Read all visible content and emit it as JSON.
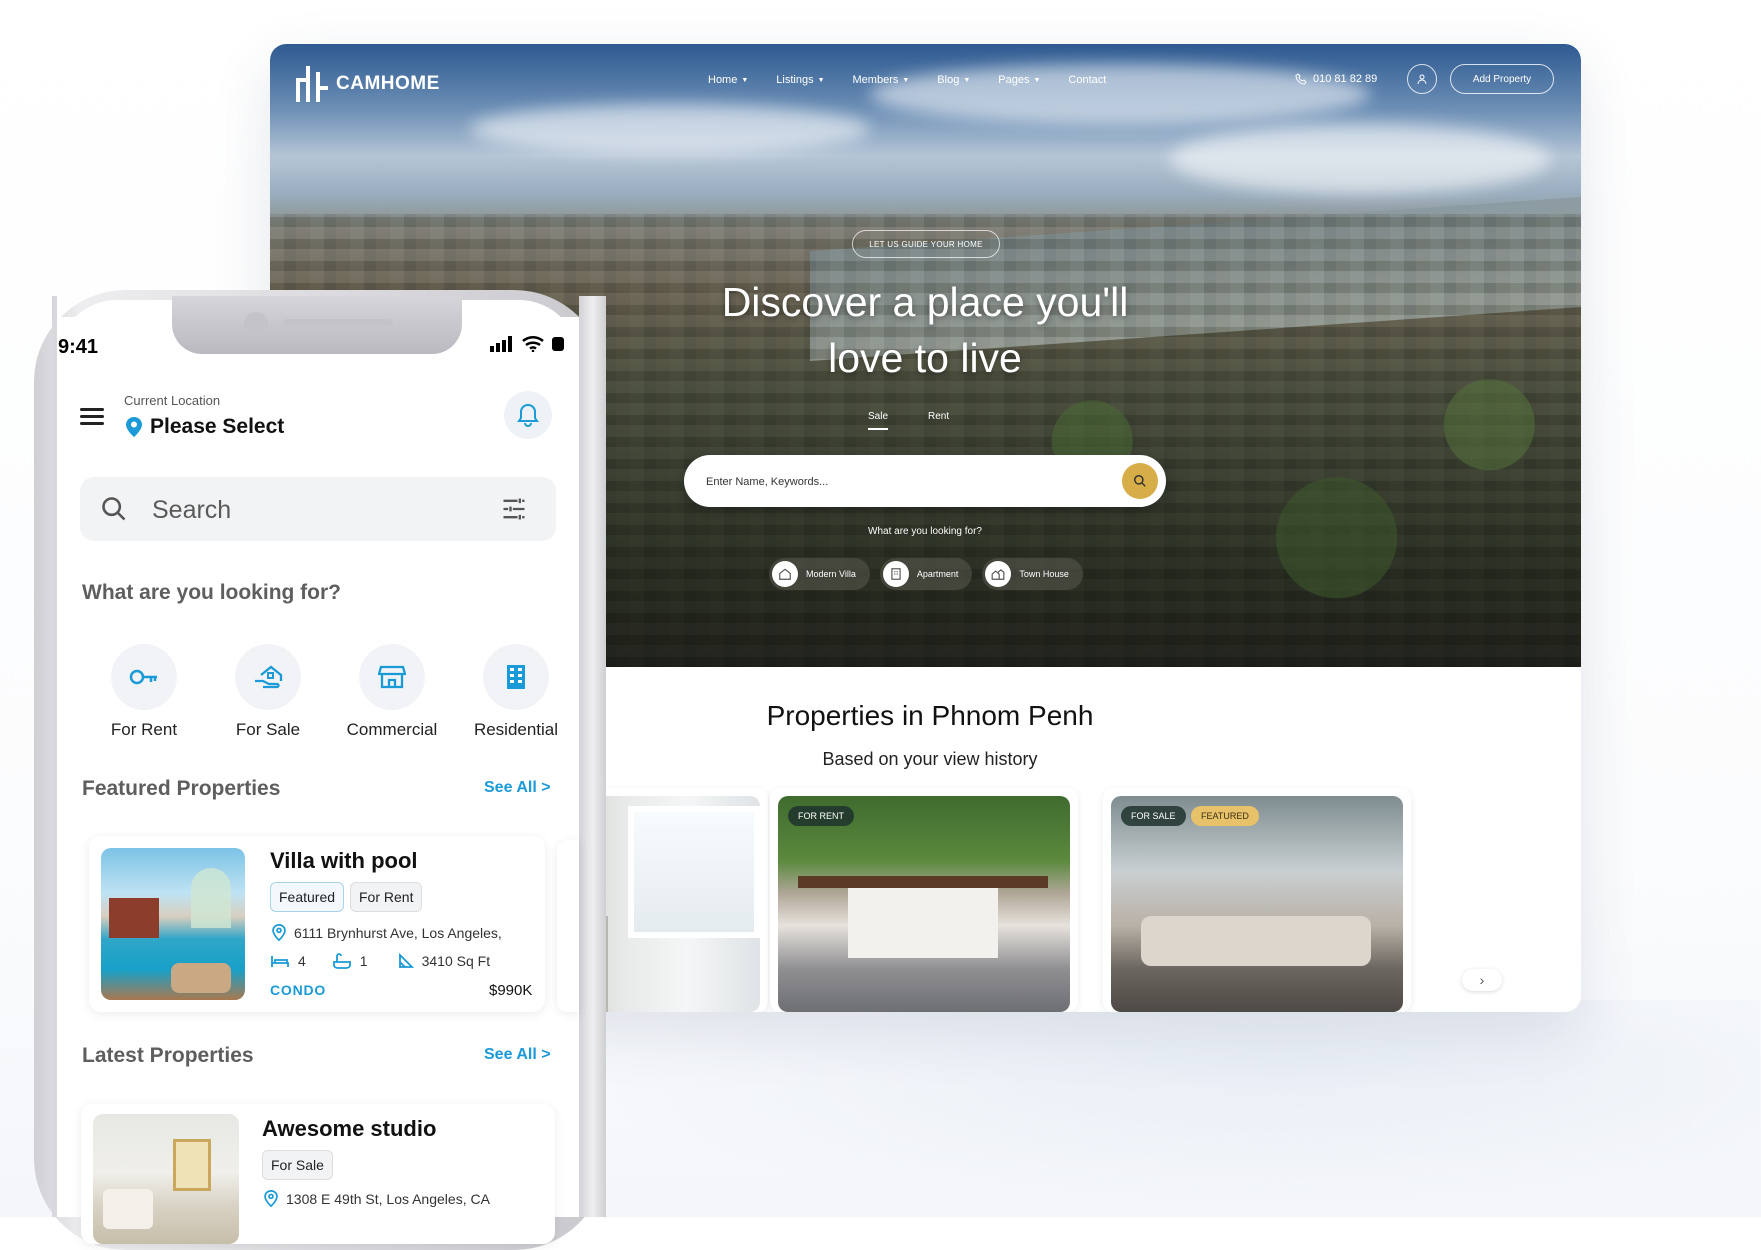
{
  "website": {
    "logo_text": "CAMHOME",
    "nav_items": [
      {
        "label": "Home"
      },
      {
        "label": "Listings"
      },
      {
        "label": "Members"
      },
      {
        "label": "Blog"
      },
      {
        "label": "Pages"
      },
      {
        "label": "Contact"
      }
    ],
    "phone": "010 81 82 89",
    "add_property": "Add Property",
    "hero": {
      "pill": "LET US GUIDE YOUR HOME",
      "title_line1": "Discover a place you'll",
      "title_line2": "love to live",
      "tab_sale": "Sale",
      "tab_rent": "Rent",
      "search_placeholder": "Enter Name, Keywords...",
      "looking_label": "What are you looking for?",
      "chips": [
        "Modern Villa",
        "Apartment",
        "Town House"
      ]
    },
    "properties_title": "Properties in Phnom Penh",
    "properties_subtitle": "Based on your view history",
    "card_tags": {
      "card2_tag1": "FOR RENT",
      "card3_tag1": "FOR SALE",
      "card3_tag2": "FEATURED"
    },
    "next_arrow": "›"
  },
  "mobile": {
    "status_time": "9:41",
    "location_label": "Current Location",
    "location_value": "Please Select",
    "search_placeholder": "Search",
    "looking_title": "What are you looking for?",
    "categories": [
      {
        "label": "For Rent",
        "icon": "key-icon"
      },
      {
        "label": "For Sale",
        "icon": "house-hand-icon"
      },
      {
        "label": "Commercial",
        "icon": "store-icon"
      },
      {
        "label": "Residential",
        "icon": "building-icon"
      }
    ],
    "featured_title": "Featured Properties",
    "latest_title": "Latest Properties",
    "see_all": "See All >",
    "featured_card": {
      "title": "Villa with pool",
      "badge1": "Featured",
      "badge2": "For Rent",
      "address": "6111 Brynhurst Ave, Los Angeles,",
      "beds": "4",
      "baths": "1",
      "area": "3410 Sq Ft",
      "type": "CONDO",
      "price": "$990K"
    },
    "latest_card": {
      "title": "Awesome studio",
      "badge1": "For Sale",
      "address": "1308 E 49th St, Los Angeles, CA"
    }
  },
  "colors": {
    "accent_blue": "#1a9ad6",
    "gold": "#d7ad47"
  }
}
